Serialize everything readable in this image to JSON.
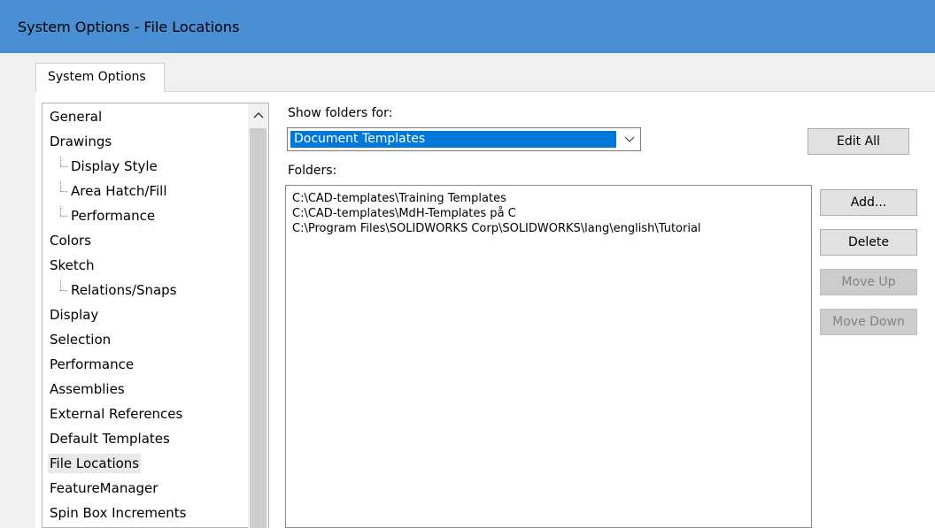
{
  "window": {
    "title": "System Options - File Locations"
  },
  "tabs": [
    {
      "label": "System Options"
    }
  ],
  "tree": {
    "items": [
      {
        "label": "General"
      },
      {
        "label": "Drawings"
      },
      {
        "label": "Display Style"
      },
      {
        "label": "Area Hatch/Fill"
      },
      {
        "label": "Performance"
      },
      {
        "label": "Colors"
      },
      {
        "label": "Sketch"
      },
      {
        "label": "Relations/Snaps"
      },
      {
        "label": "Display"
      },
      {
        "label": "Selection"
      },
      {
        "label": "Performance"
      },
      {
        "label": "Assemblies"
      },
      {
        "label": "External References"
      },
      {
        "label": "Default Templates"
      },
      {
        "label": "File Locations"
      },
      {
        "label": "FeatureManager"
      },
      {
        "label": "Spin Box Increments"
      }
    ],
    "selected": "File Locations",
    "scroll_up_icon": "^"
  },
  "show_folders": {
    "label": "Show folders for:",
    "value": "Document Templates",
    "chevron": "⌄"
  },
  "folders": {
    "label": "Folders:",
    "rows": [
      "C:\\CAD-templates\\Training Templates",
      "C:\\CAD-templates\\MdH-Templates på C",
      "C:\\Program Files\\SOLIDWORKS Corp\\SOLIDWORKS\\lang\\english\\Tutorial"
    ]
  },
  "buttons": {
    "edit_all": "Edit All",
    "add": "Add...",
    "delete": "Delete",
    "move_up": "Move Up",
    "move_down": "Move Down"
  },
  "colors": {
    "titlebar": "#4a8fd4",
    "selection": "#0078d7"
  }
}
